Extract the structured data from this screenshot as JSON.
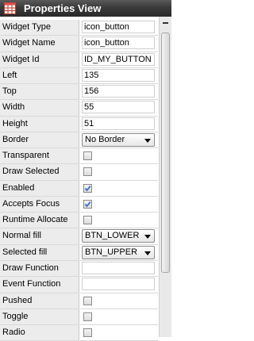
{
  "window": {
    "title": "Properties View",
    "icon": "grid-icon"
  },
  "rows": [
    {
      "label": "Widget Type",
      "kind": "text",
      "value": "icon_button"
    },
    {
      "label": "Widget Name",
      "kind": "text",
      "value": "icon_button"
    },
    {
      "label": "Widget Id",
      "kind": "text",
      "value": "ID_MY_BUTTON"
    },
    {
      "label": "Left",
      "kind": "text",
      "value": "135"
    },
    {
      "label": "Top",
      "kind": "text",
      "value": "156"
    },
    {
      "label": "Width",
      "kind": "text",
      "value": "55"
    },
    {
      "label": "Height",
      "kind": "text",
      "value": "51"
    },
    {
      "label": "Border",
      "kind": "dropdown",
      "value": "No Border"
    },
    {
      "label": "Transparent",
      "kind": "checkbox",
      "checked": false
    },
    {
      "label": "Draw Selected",
      "kind": "checkbox",
      "checked": false
    },
    {
      "label": "Enabled",
      "kind": "checkbox",
      "checked": true
    },
    {
      "label": "Accepts Focus",
      "kind": "checkbox",
      "checked": true
    },
    {
      "label": "Runtime Allocate",
      "kind": "checkbox",
      "checked": false
    },
    {
      "label": "Normal fill",
      "kind": "dropdown",
      "value": "BTN_LOWER"
    },
    {
      "label": "Selected fill",
      "kind": "dropdown",
      "value": "BTN_UPPER"
    },
    {
      "label": "Draw Function",
      "kind": "text",
      "value": ""
    },
    {
      "label": "Event Function",
      "kind": "text",
      "value": ""
    },
    {
      "label": "Pushed",
      "kind": "checkbox",
      "checked": false
    },
    {
      "label": "Toggle",
      "kind": "checkbox",
      "checked": false
    },
    {
      "label": "Radio",
      "kind": "checkbox",
      "checked": false
    }
  ],
  "colors": {
    "titlebar": "#3a3a3a",
    "label_bg": "#ececec",
    "check": "#3a6fc4"
  }
}
